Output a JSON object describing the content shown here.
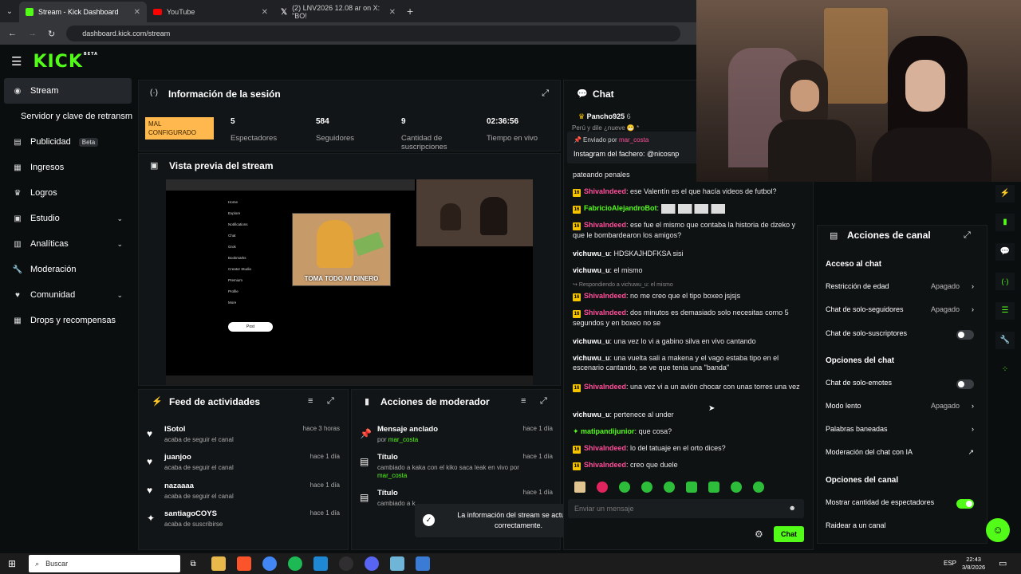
{
  "browser": {
    "tabs": [
      {
        "label": "Stream - Kick Dashboard",
        "icon": "kick-icon"
      },
      {
        "label": "YouTube",
        "icon": "youtube-icon"
      },
      {
        "label": "(2) LNV2026 12.08 ar on X: \"BO!",
        "icon": "x-icon"
      }
    ],
    "new_tab": "+",
    "url": "dashboard.kick.com/stream"
  },
  "kick": {
    "logo": "KICK",
    "logo_sup": "BETA"
  },
  "sidebar": {
    "items": [
      {
        "label": "Stream"
      },
      {
        "label": "Servidor y clave de retransm"
      },
      {
        "label": "Publicidad",
        "badge": "Beta"
      },
      {
        "label": "Ingresos"
      },
      {
        "label": "Logros"
      },
      {
        "label": "Estudio"
      },
      {
        "label": "Analíticas"
      },
      {
        "label": "Moderación"
      },
      {
        "label": "Comunidad"
      },
      {
        "label": "Drops y recompensas"
      }
    ]
  },
  "session": {
    "title": "Información de la sesión",
    "tag": "MAL CONFIGURADO",
    "stats": [
      {
        "value": "5",
        "label": "Espectadores"
      },
      {
        "value": "584",
        "label": "Seguidores"
      },
      {
        "value": "9",
        "label": "Cantidad de suscripciones"
      },
      {
        "value": "02:36:56",
        "label": "Tiempo en vivo"
      }
    ]
  },
  "preview": {
    "title": "Vista previa del stream",
    "meme_caption": "TOMA TODO MI DINERO",
    "x_menu": [
      "Home",
      "Explore",
      "Notifications",
      "Chat",
      "Grok",
      "Bookmarks",
      "Creator Studio",
      "Premium",
      "Profile",
      "More"
    ],
    "x_post_button": "Post"
  },
  "feed": {
    "title": "Feed de actividades",
    "items": [
      {
        "name": "lSotol",
        "action": "acaba de seguir el canal",
        "time": "hace 3 horas",
        "icon": "heart-icon"
      },
      {
        "name": "juanjoo",
        "action": "acaba de seguir el canal",
        "time": "hace 1 día",
        "icon": "heart-icon"
      },
      {
        "name": "nazaaaa",
        "action": "acaba de seguir el canal",
        "time": "hace 1 día",
        "icon": "heart-icon"
      },
      {
        "name": "santiagoCOYS",
        "action": "acaba de suscribirse",
        "time": "hace 1 día",
        "icon": "star-icon"
      }
    ]
  },
  "modactions": {
    "title": "Acciones de moderador",
    "items": [
      {
        "title": "Mensaje anclado",
        "line": "por",
        "user": "mar_costa",
        "time": "hace 1 día"
      },
      {
        "title": "Título",
        "line": "cambiado a kaka con el kiko saca leak en vivo por",
        "user": "mar_costa",
        "time": "hace 1 día"
      },
      {
        "title": "Título",
        "line": "cambiado a k",
        "user": "",
        "time": "hace 1 día"
      }
    ]
  },
  "toast": {
    "text": "La información del stream se actualizó correctamente."
  },
  "chat": {
    "title": "Chat",
    "top_user": "Pancho925",
    "top_user_count": "6",
    "top_msg": "Perú y dile ¿nueve 😁 *",
    "pinned_by_label": "Enviado por",
    "pinned_by": "mar_costa",
    "pinned_text": "Instagram del fachero: @nicosnp",
    "messages": [
      {
        "user": "",
        "text": "pateando penales",
        "color": "white"
      },
      {
        "user": "ShivaIndeed",
        "text": "ese Valentín es el que hacía videos de futbol?",
        "color": "pink",
        "badge": "16"
      },
      {
        "user": "FabricioAlejandroBot",
        "text": "",
        "color": "green",
        "badge": "16"
      },
      {
        "user": "ShivaIndeed",
        "text": "ese fue el mismo que contaba la historia de dzeko y que le bombardearon los amigos?",
        "color": "pink",
        "badge": "16"
      },
      {
        "user": "vichuwu_u",
        "text": "HDSKAJHDFKSA sisi",
        "color": "white"
      },
      {
        "user": "vichuwu_u",
        "text": "el mismo",
        "color": "white"
      },
      {
        "user": "",
        "text": "Respondiendo a vichuwu_u: el mismo",
        "color": "white"
      },
      {
        "user": "ShivaIndeed",
        "text": "no me creo que el tipo boxeo jsjsjs",
        "color": "pink",
        "badge": "16"
      },
      {
        "user": "ShivaIndeed",
        "text": "dos minutos es demasiado solo necesitas como 5 segundos y en boxeo no se",
        "color": "pink",
        "badge": "16"
      },
      {
        "user": "vichuwu_u",
        "text": "una vez lo vi a gabino silva en vivo cantando",
        "color": "white"
      },
      {
        "user": "vichuwu_u",
        "text": "una vuelta sali a makena y el vago estaba tipo en el escenario cantando, se ve que tenia una \"banda\"",
        "color": "white"
      },
      {
        "user": "ShivaIndeed",
        "text": "una vez vi a un avión chocar con unas torres una vez",
        "color": "pink",
        "badge": "16"
      },
      {
        "user": "vichuwu_u",
        "text": "pertenece al under",
        "color": "white"
      },
      {
        "user": "matipandijunior",
        "text": "que cosa?",
        "color": "green"
      },
      {
        "user": "ShivaIndeed",
        "text": "lo del tatuaje en el orto dices?",
        "color": "pink",
        "badge": "16"
      },
      {
        "user": "ShivaIndeed",
        "text": "creo que duele",
        "color": "pink",
        "badge": "16"
      }
    ],
    "input_placeholder": "Enviar un mensaje",
    "send_label": "Chat"
  },
  "channel_actions": {
    "title": "Acciones de canal",
    "sections": [
      {
        "heading": "Acceso al chat",
        "rows": [
          {
            "label": "Restricción de edad",
            "value": "Apagado",
            "type": "arrow"
          },
          {
            "label": "Chat de solo-seguidores",
            "value": "Apagado",
            "type": "arrow"
          },
          {
            "label": "Chat de solo-suscriptores",
            "value": "",
            "type": "toggle",
            "on": false
          }
        ]
      },
      {
        "heading": "Opciones del chat",
        "rows": [
          {
            "label": "Chat de solo-emotes",
            "value": "",
            "type": "toggle",
            "on": false
          },
          {
            "label": "Modo lento",
            "value": "Apagado",
            "type": "arrow"
          },
          {
            "label": "Palabras baneadas",
            "value": "",
            "type": "arrow"
          },
          {
            "label": "Moderación del chat con IA",
            "value": "",
            "type": "external"
          }
        ]
      },
      {
        "heading": "Opciones del canal",
        "rows": [
          {
            "label": "Mostrar cantidad de espectadores",
            "value": "",
            "type": "toggle",
            "on": true
          },
          {
            "label": "Raidear a un canal",
            "value": "",
            "type": "none"
          }
        ]
      }
    ]
  },
  "taskbar": {
    "search": "Buscar",
    "lang": "ESP",
    "time": "22:43",
    "date": "3/8/2026"
  },
  "colors": {
    "accent": "#53fc18",
    "pink": "#ff4d9a",
    "warn": "#ffb84d"
  }
}
